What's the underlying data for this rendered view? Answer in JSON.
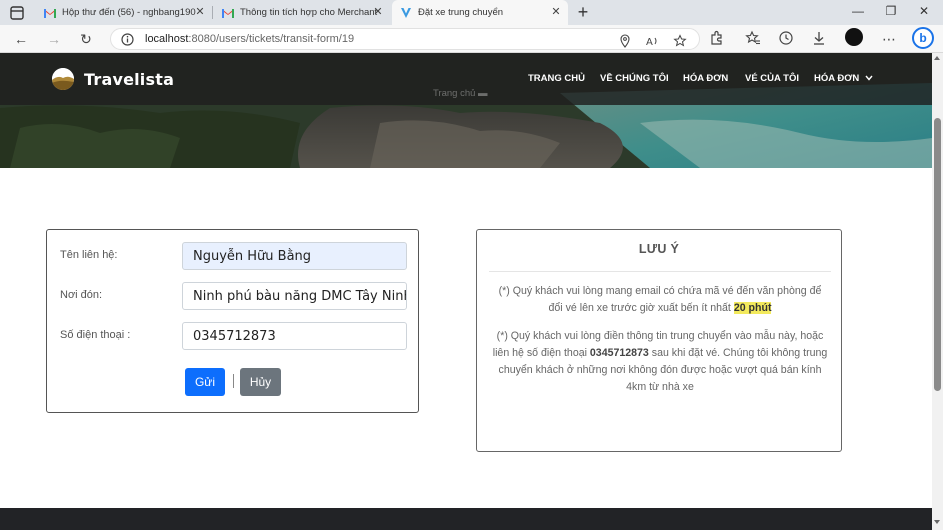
{
  "browser": {
    "tabs": [
      {
        "label": "Hộp thư đến (56) - nghbang190",
        "favicon": "gmail-icon"
      },
      {
        "label": "Thông tin tích hợp cho Merchant",
        "favicon": "gmail-icon"
      },
      {
        "label": "Đặt xe trung chuyển",
        "favicon": "v-logo-icon",
        "active": true
      }
    ],
    "url_host": "localhost",
    "url_path": ":8080/users/tickets/transit-form/19",
    "bing_label": "b"
  },
  "site": {
    "brand": "Travelista",
    "nav": [
      "TRANG CHỦ",
      "VỀ CHÚNG TÔI",
      "HÓA ĐƠN",
      "VÉ CỦA TÔI",
      "HÓA ĐƠN"
    ],
    "ghost_link": "Trang chủ ▬"
  },
  "form": {
    "contact_label": "Tên liên hệ:",
    "contact_value": "Nguyễn Hữu Bằng",
    "pickup_label": "Nơi đón:",
    "pickup_value": "Ninh phú bàu năng DMC Tây Ninh",
    "phone_label": "Số điện thoại :",
    "phone_value": "0345712873",
    "submit_label": "Gửi",
    "cancel_label": "Hủy"
  },
  "note": {
    "title": "LƯU Ý",
    "p1_text": "(*) Quý khách vui lòng mang email có chứa mã vé đến văn phòng để đổi vé lên xe trước giờ xuất bến ít nhất ",
    "p1_highlight": "20 phút",
    "p2_before": "(*) Quý khách vui lòng điền thông tin trung chuyển vào mẫu này, hoặc liên hệ số điện thoại ",
    "p2_phone": "0345712873",
    "p2_after": " sau khi đặt vé. Chúng tôi không trung chuyển khách ở những nơi không đón được hoặc vượt quá bán kính 4km từ nhà xe"
  },
  "colors": {
    "primary_button": "#0d6efd",
    "secondary_button": "#6c757d",
    "highlight": "#f3ea5d"
  }
}
